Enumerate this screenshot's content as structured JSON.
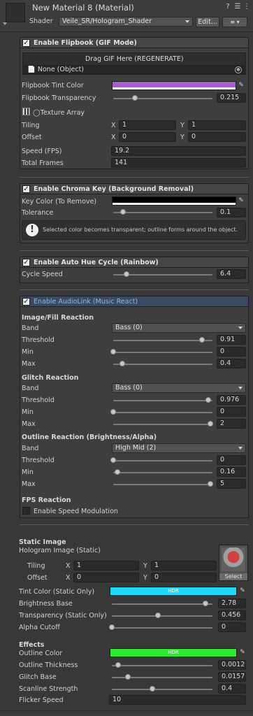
{
  "header": {
    "title": "New Material 8 (Material)",
    "shader_label": "Shader",
    "shader_value": "Veile_SR/Hologram_Shader",
    "edit_button": "Edit...",
    "list_button": "≡ ▾",
    "icons": [
      "help-icon",
      "settings-sliders-icon",
      "more-icon"
    ]
  },
  "flipbook": {
    "enable_label": "Enable Flipbook (GIF Mode)",
    "enabled": true,
    "drag_button": "Drag GIF Here (REGENERATE)",
    "object_field": "None (Object)",
    "tint_label": "Flipbook Tint Color",
    "tint_color": "#a060d0",
    "transparency_label": "Flipbook Transparency",
    "transparency_value": "0.215",
    "texture_array_label": "Texture Array",
    "tiling_label": "Tiling",
    "tiling_x": "1",
    "tiling_y": "1",
    "offset_label": "Offset",
    "offset_x": "0",
    "offset_y": "0",
    "x_label": "X",
    "y_label": "Y",
    "speed_label": "Speed (FPS)",
    "speed_value": "19.2",
    "frames_label": "Total Frames",
    "frames_value": "141"
  },
  "chroma": {
    "enable_label": "Enable Chroma Key (Background Removal)",
    "enabled": true,
    "key_label": "Key Color (To Remove)",
    "key_color": "#000000",
    "tolerance_label": "Tolerance",
    "tolerance_value": "0.1",
    "info_text": "Selected color becomes transparent; outline forms around the object."
  },
  "hue": {
    "enable_label": "Enable Auto Hue Cycle (Rainbow)",
    "enabled": true,
    "speed_label": "Cycle Speed",
    "speed_value": "6.4"
  },
  "audiolink": {
    "enable_label": "Enable AudioLink (Music React)",
    "enabled": true,
    "image_section": "Image/Fill Reaction",
    "band_label": "Band",
    "threshold_label": "Threshold",
    "min_label": "Min",
    "max_label": "Max",
    "image_band": "Bass (0)",
    "image_threshold": "0.91",
    "image_min": "0",
    "image_max": "0.4",
    "glitch_section": "Glitch Reaction",
    "glitch_band": "Bass (0)",
    "glitch_threshold": "0.976",
    "glitch_min": "0",
    "glitch_max": "2",
    "outline_section": "Outline Reaction (Brightness/Alpha)",
    "outline_band": "High Mid (2)",
    "outline_threshold": "0",
    "outline_min": "0.16",
    "outline_max": "5",
    "fps_section": "FPS Reaction",
    "speed_mod_label": "Enable Speed Modulation",
    "speed_mod_enabled": false
  },
  "static": {
    "section": "Static Image",
    "texture_label": "Hologram Image (Static)",
    "select_button": "Select",
    "tiling_label": "Tiling",
    "tiling_x": "1",
    "tiling_y": "1",
    "offset_label": "Offset",
    "offset_x": "0",
    "offset_y": "0",
    "x_label": "X",
    "y_label": "Y",
    "tint_label": "Tint Color (Static Only)",
    "tint_color": "#20d8f8",
    "hdr_label": "HDR",
    "brightness_label": "Brightness Base",
    "brightness_value": "2.78",
    "transparency_label": "Transparency (Static Only)",
    "transparency_value": "0.456",
    "alpha_label": "Alpha Cutoff",
    "alpha_value": "0"
  },
  "effects": {
    "section": "Effects",
    "outline_color_label": "Outline Color",
    "outline_color": "#30e830",
    "hdr_label": "HDR",
    "thickness_label": "Outline Thickness",
    "thickness_value": "0.0012",
    "glitch_label": "Glitch Base",
    "glitch_value": "0.0157",
    "scanline_label": "Scanline Strength",
    "scanline_value": "0.4",
    "flicker_label": "Flicker Speed",
    "flicker_value": "10"
  }
}
